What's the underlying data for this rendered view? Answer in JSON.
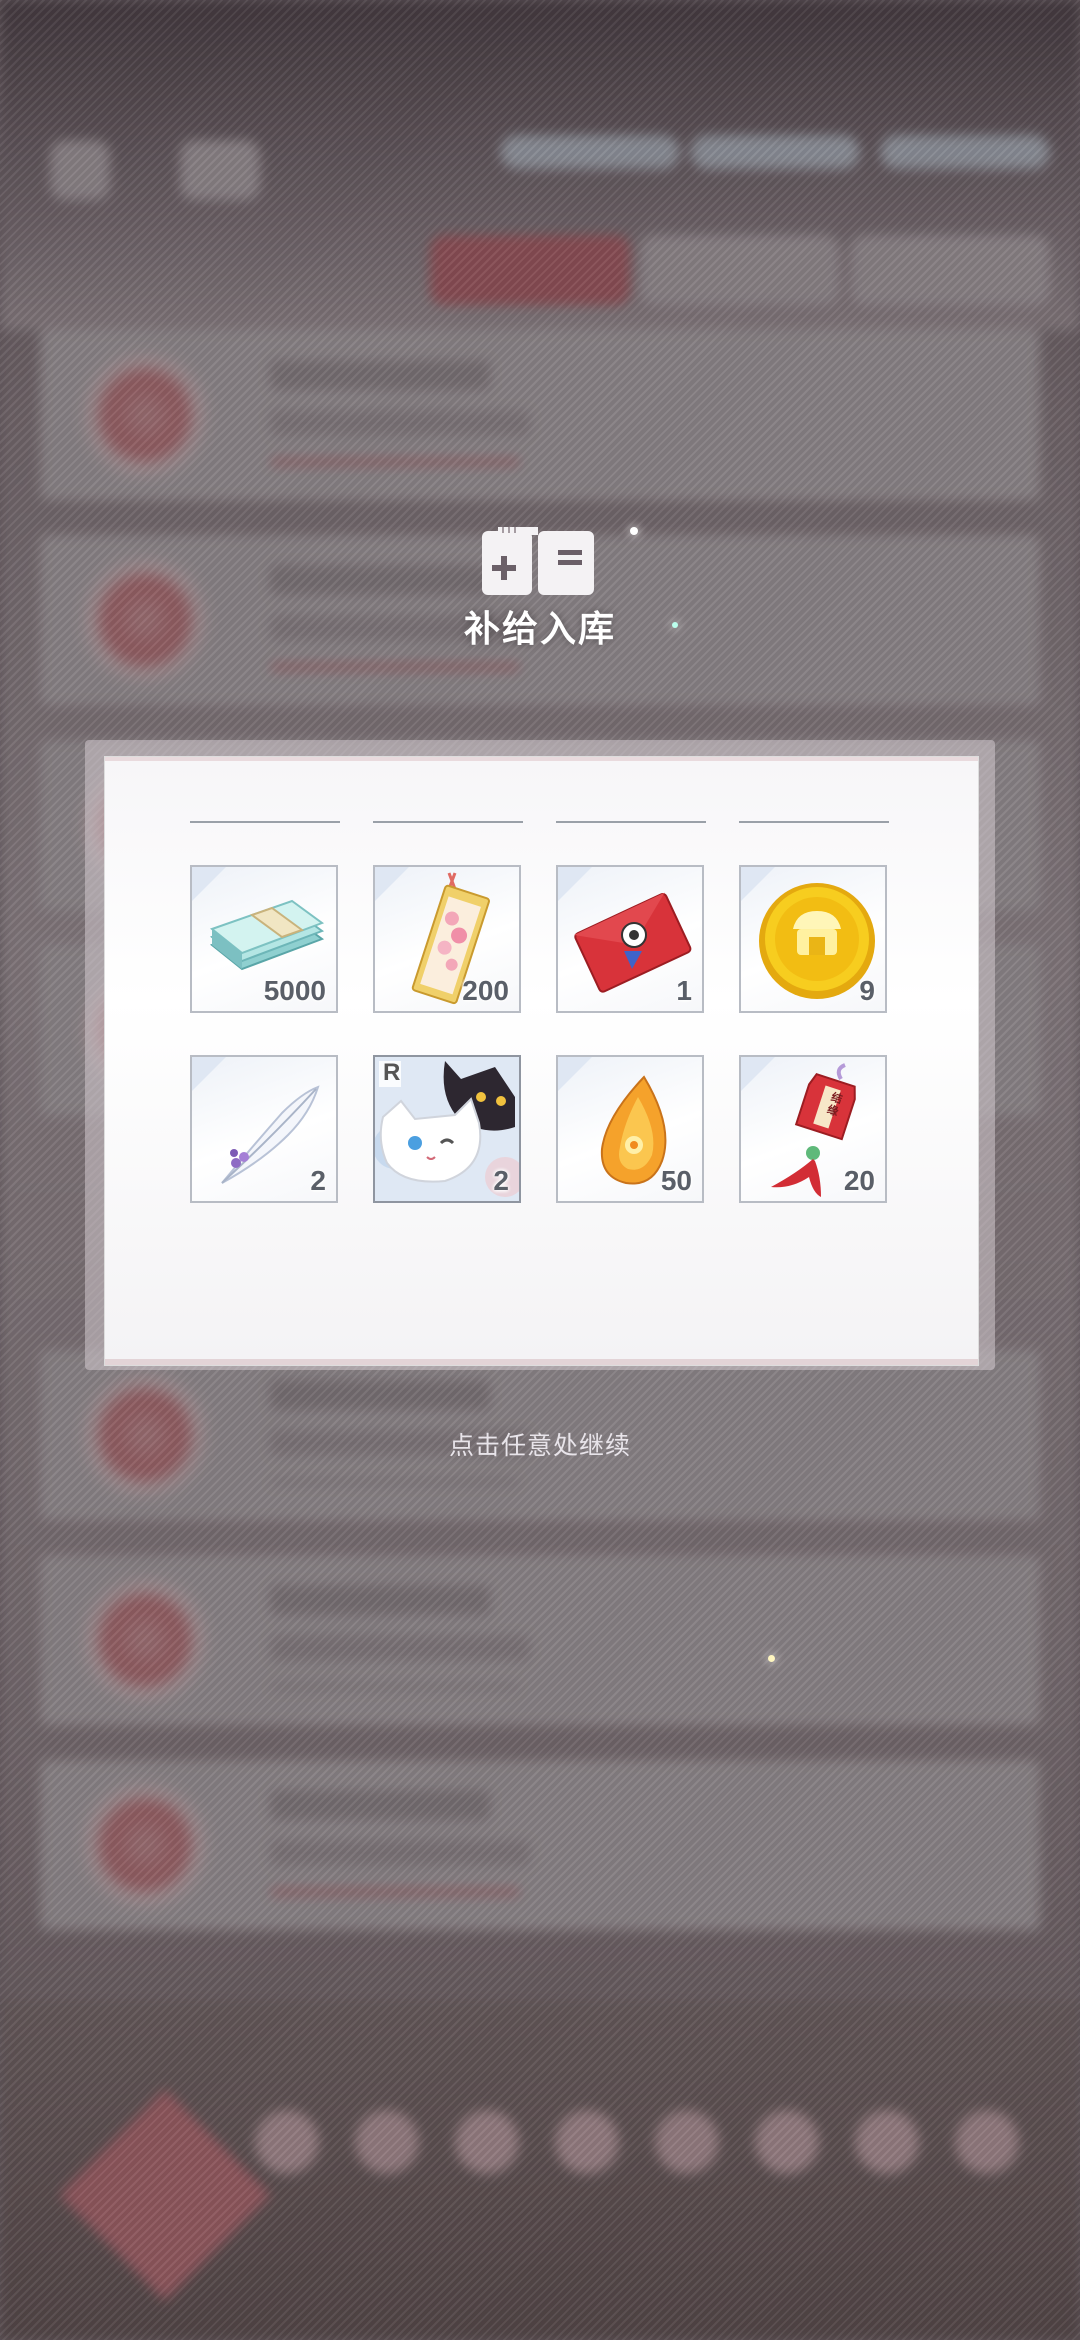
{
  "modal": {
    "title": "补给入库",
    "continue_hint": "点击任意处继续"
  },
  "rewards": [
    {
      "name": "cash-stack-icon",
      "quantity": "5000"
    },
    {
      "name": "sakura-bookmark-icon",
      "quantity": "200"
    },
    {
      "name": "red-envelope-icon",
      "quantity": "1"
    },
    {
      "name": "gold-coin-icon",
      "quantity": "9"
    },
    {
      "name": "white-feather-icon",
      "quantity": "2"
    },
    {
      "name": "cat-card-icon",
      "quantity": "2",
      "rarity": "R"
    },
    {
      "name": "amber-drop-icon",
      "quantity": "50"
    },
    {
      "name": "omamori-charm-icon",
      "quantity": "20",
      "charm_text": "结缘"
    }
  ],
  "colors": {
    "panel": "#ffffff",
    "quantity_text": "#5a5f68",
    "title_text": "#ffffff",
    "accent_red": "#d33a3f"
  }
}
